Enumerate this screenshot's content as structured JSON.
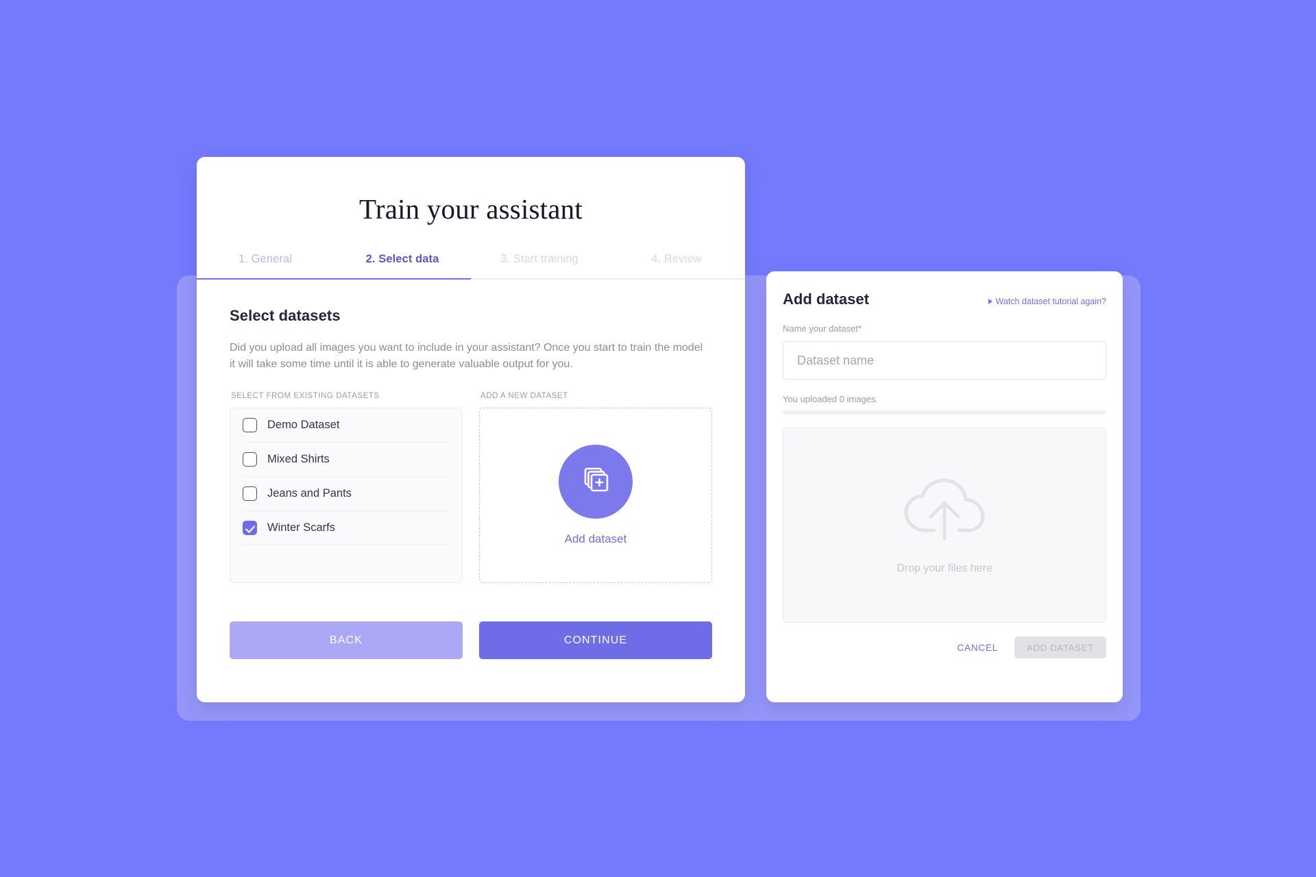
{
  "theme": {
    "background": "#757afd",
    "backdrop_panel": "#a8a8f7",
    "accent": "#6f6ce8",
    "accent_light": "#aba9f5",
    "card": "#ffffff"
  },
  "main_card": {
    "title": "Train your assistant",
    "tabs": [
      {
        "label": "1. General",
        "state": "done"
      },
      {
        "label": "2. Select data",
        "state": "active"
      },
      {
        "label": "3. Start training",
        "state": "upcoming"
      },
      {
        "label": "4. Review",
        "state": "upcoming"
      }
    ],
    "section_title": "Select datasets",
    "section_desc": "Did you upload all images you want to include in your assistant? Once you start to train the model it will take some time until it is able to generate valuable output for you.",
    "existing": {
      "label": "SELECT FROM EXISTING DATASETS",
      "items": [
        {
          "name": "Demo Dataset",
          "checked": false
        },
        {
          "name": "Mixed Shirts",
          "checked": false
        },
        {
          "name": "Jeans and Pants",
          "checked": false
        },
        {
          "name": "Winter Scarfs",
          "checked": true
        }
      ]
    },
    "add_new": {
      "label": "ADD A NEW DATASET",
      "icon": "stacked-images-plus-icon",
      "cta": "Add dataset"
    },
    "buttons": {
      "back": "BACK",
      "continue": "CONTINUE"
    }
  },
  "side_card": {
    "title": "Add dataset",
    "tutorial_link": "Watch dataset tutorial again?",
    "name_label": "Name your dataset*",
    "name_value": "",
    "name_placeholder": "Dataset name",
    "upload_status": "You uploaded 0 images.",
    "upload_progress_percent": 0,
    "dropzone": {
      "icon": "cloud-upload-icon",
      "text": "Drop your files here"
    },
    "actions": {
      "cancel": "CANCEL",
      "submit": "ADD DATASET",
      "submit_disabled": true
    }
  }
}
